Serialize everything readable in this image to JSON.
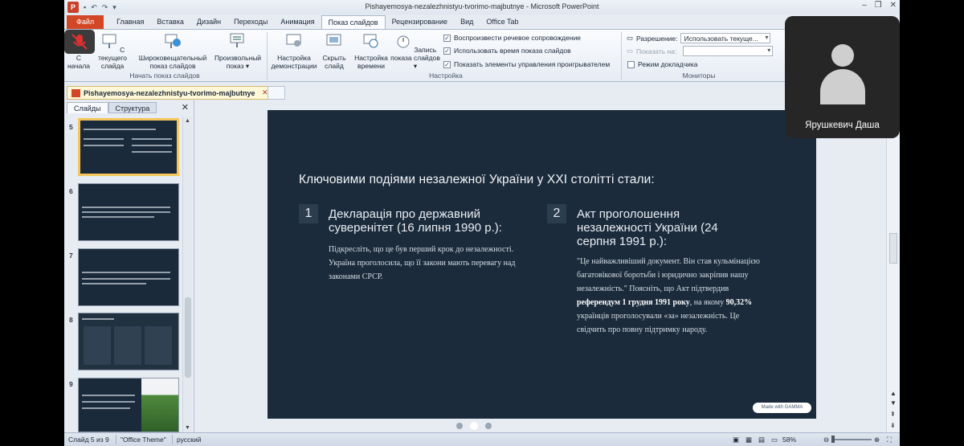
{
  "window": {
    "title": "Pishayemosya-nezalezhnistyu-tvorimo-majbutnye - Microsoft PowerPoint",
    "logo_letter": "P"
  },
  "ribbon_tabs": [
    "Файл",
    "Главная",
    "Вставка",
    "Дизайн",
    "Переходы",
    "Анимация",
    "Показ слайдов",
    "Рецензирование",
    "Вид",
    "Office Tab"
  ],
  "ribbon": {
    "start_group": {
      "label": "Начать показ слайдов",
      "buttons": [
        "С начала",
        "С текущего слайда",
        "Широковещательный показ слайдов",
        "Произвольный показ"
      ]
    },
    "setup_group": {
      "label": "Настройка",
      "buttons": [
        "Настройка демонстрации",
        "Скрыть слайд",
        "Настройка времени",
        "Запись показа слайдов"
      ],
      "checkboxes": [
        {
          "label": "Воспроизвести речевое сопровождение",
          "checked": true
        },
        {
          "label": "Использовать время показа слайдов",
          "checked": true
        },
        {
          "label": "Показать элементы управления проигрывателем",
          "checked": true
        }
      ]
    },
    "monitors_group": {
      "label": "Мониторы",
      "resolution_label": "Разрешение:",
      "resolution_value": "Использовать текуще...",
      "show_on_label": "Показать на:",
      "presenter_mode": "Режим докладчика"
    }
  },
  "document_tab": "Pishayemosya-nezalezhnistyu-tvorimo-majbutnye",
  "left_pane": {
    "tabs": [
      "Слайды",
      "Структура"
    ],
    "slide_numbers": [
      "5",
      "6",
      "7",
      "8",
      "9"
    ]
  },
  "slide": {
    "title": "Ключовими подіями незалежної України у XXI столітті стали:",
    "col1": {
      "num": "1",
      "heading_line1": "Декларація про державний",
      "heading_line2": "суверенітет (16 липня 1990 р.):",
      "body_line1": "Підкресліть, що це був перший крок до незалежності.",
      "body_line2": "Україна проголосила, що її закони мають перевагу над",
      "body_line3": "законами СРСР."
    },
    "col2": {
      "num": "2",
      "heading_line1": "Акт проголошення",
      "heading_line2": "незалежності України (24",
      "heading_line3": "серпня 1991 р.):",
      "body_line1": "\"Це найважливіший документ. Він став кульмінацією",
      "body_line2": "багатовікової боротьби і юридично закріпив нашу",
      "body_line3": "незалежність.\" Поясніть, що Акт підтвердив",
      "body_bold1": "референдум 1 грудня 1991 року",
      "body_line4_rest": ", на якому",
      "body_bold2": "90,32%",
      "body_line5": "українців проголосували «за» незалежність. Це",
      "body_line6": "свідчить про повну підтримку народу."
    },
    "badge": "Made with GAMMA"
  },
  "status_bar": {
    "slide_info": "Слайд 5 из 9",
    "theme": "\"Office Theme\"",
    "language": "русский",
    "zoom": "58%"
  },
  "participant": {
    "name": "Ярушкевич Даша"
  }
}
